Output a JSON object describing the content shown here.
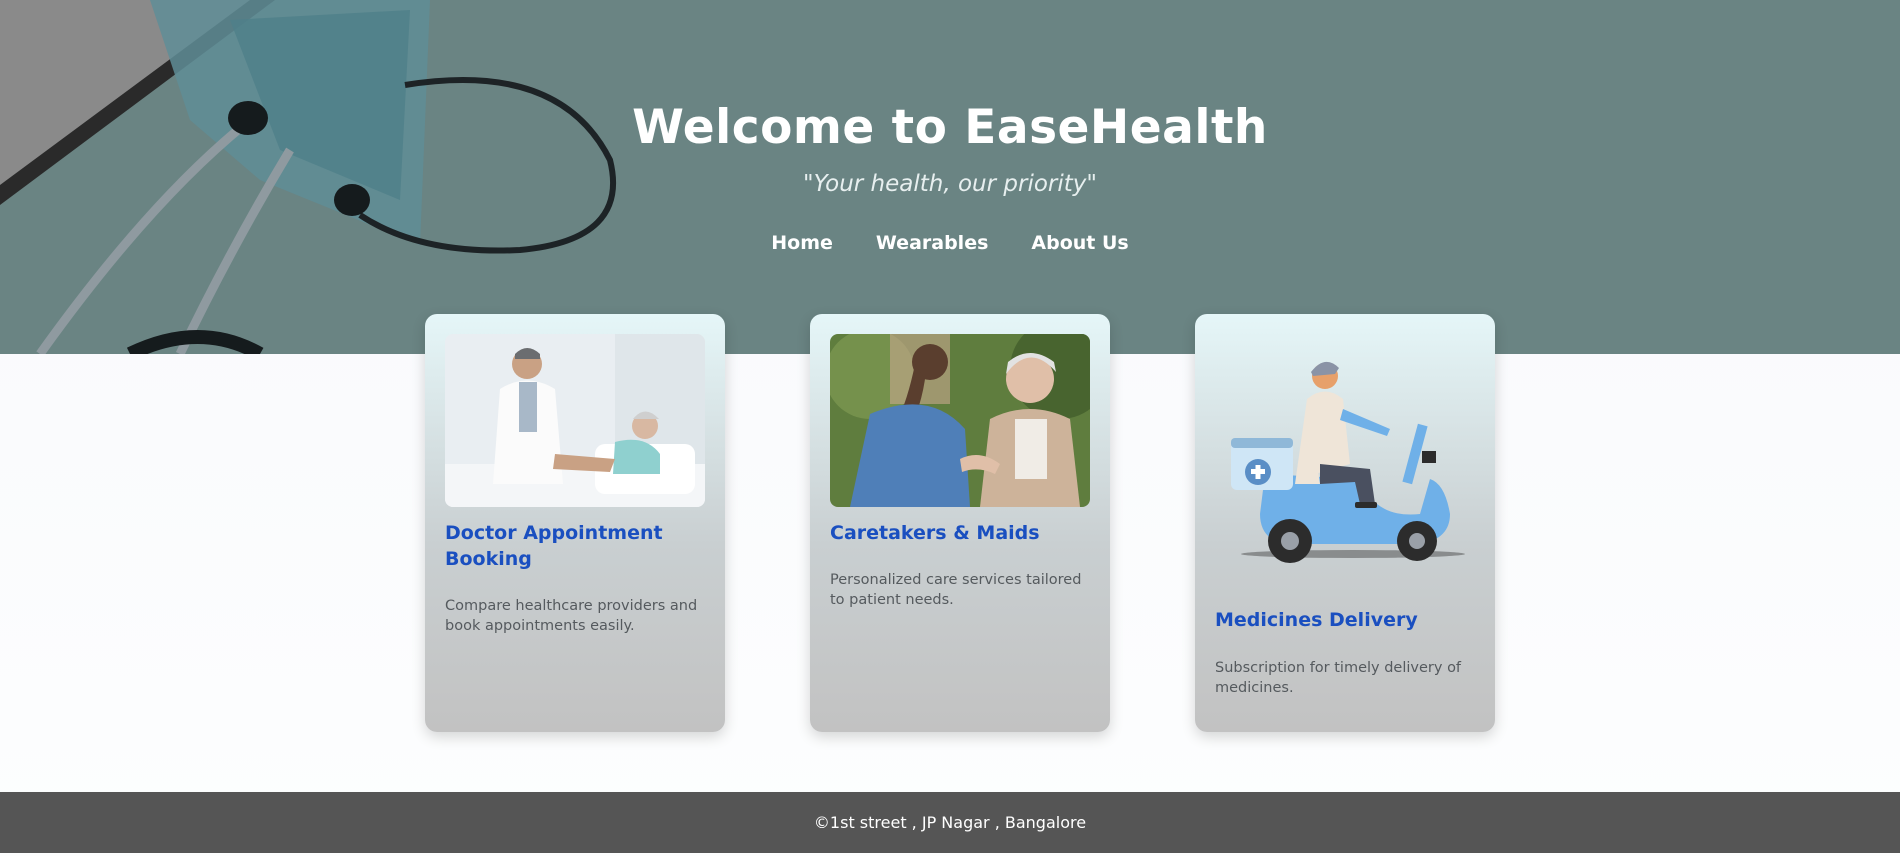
{
  "hero": {
    "title": "Welcome to EaseHealth",
    "tagline": "\"Your health, our priority\""
  },
  "nav": {
    "items": [
      {
        "label": "Home"
      },
      {
        "label": "Wearables"
      },
      {
        "label": "About Us"
      }
    ]
  },
  "cards": [
    {
      "title": "Doctor Appointment Booking",
      "description": "Compare healthcare providers and book appointments easily.",
      "image": "doctor-with-patient-photo"
    },
    {
      "title": "Caretakers & Maids",
      "description": "Personalized care services tailored to patient needs.",
      "image": "caretaker-with-elderly-woman-photo"
    },
    {
      "title": "Medicines Delivery",
      "description": "Subscription for timely delivery of medicines.",
      "image": "delivery-scooter-illustration"
    }
  ],
  "footer": {
    "text": "©1st street , JP Nagar , Bangalore"
  },
  "colors": {
    "hero_bg": "#6a8483",
    "card_title": "#1a4fc0",
    "footer_bg": "#555555"
  }
}
